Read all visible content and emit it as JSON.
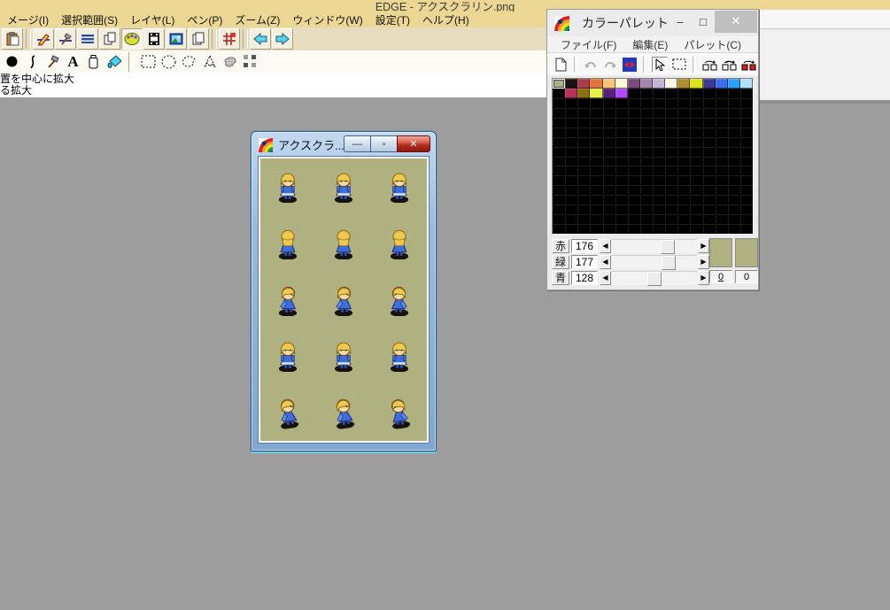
{
  "main_window": {
    "title": "EDGE - アクスクラリン.png",
    "menu_items": [
      "メージ(I)",
      "選択範囲(S)",
      "レイヤ(L)",
      "ペン(P)",
      "ズーム(Z)",
      "ウィンドウ(W)",
      "設定(T)",
      "ヘルプ(H)"
    ],
    "status_lines": [
      "置を中心に拡大",
      "る拡大"
    ],
    "colors": {
      "titlebar": "#ecd694",
      "toolbar": "#e6dcc0",
      "client_area": "#9d9d9d"
    }
  },
  "sprite_window": {
    "title": "アクスクラ...",
    "caption_buttons": {
      "minimize": "—",
      "restore": "▫",
      "close": "✕"
    },
    "canvas_color": "#b0b180",
    "sprite_sheet": {
      "rows": 5,
      "cols": 3,
      "subject": "blonde-girl-blue-dress-walk-cycle",
      "row_poses": [
        "front-stand",
        "back",
        "side-walk",
        "front-walk",
        "side-run"
      ],
      "row_flips": [
        [
          1,
          1,
          1
        ],
        [
          1,
          1,
          1
        ],
        [
          1,
          1,
          -1
        ],
        [
          1,
          1,
          1
        ],
        [
          1,
          1,
          -1
        ]
      ]
    }
  },
  "palette_window": {
    "title": "カラーパレット",
    "caption_buttons": {
      "minimize": "–",
      "maximize": "□",
      "close": "✕"
    },
    "menu_items": [
      "ファイル(F)",
      "編集(E)",
      "パレット(C)"
    ],
    "toolbar_icons": [
      "new-file-icon",
      "undo-icon",
      "redo-icon",
      "swap-colors-icon",
      "cursor-icon",
      "select-rect-icon",
      "copy-palette-icon",
      "copy-palette-multi-icon",
      "copy-palette-fill-icon"
    ],
    "grid": {
      "cols": 16,
      "rows": 16,
      "selected_index": 0,
      "row1": [
        "#b0b180",
        "#1f0f12",
        "#a93d49",
        "#e0763a",
        "#fec47d",
        "#fdfcd4",
        "#7d4a7c",
        "#a286ab",
        "#c2b5d5",
        "#fdf8e3",
        "#b08d30",
        "#dde414",
        "#3d3a92",
        "#3b6dee",
        "#2fa1f5",
        "#b2e2fd"
      ],
      "row2": [
        "#000000",
        "#b93058",
        "#8d7013",
        "#e9f148",
        "#58207d",
        "#b049f9"
      ],
      "fill_color": "#000000"
    },
    "rgb": {
      "red_label": "赤",
      "red": 176,
      "green_label": "緑",
      "green": 177,
      "blue_label": "青",
      "blue": 128,
      "max": 255
    },
    "current_color": "#b0b180",
    "index_left": "0",
    "index_right": "0"
  },
  "toolbar1_icons": [
    "paste-icon",
    "pencil-edit-icon",
    "hammer-tool-icon",
    "dither-screen-icon",
    "copy-pages-icon",
    "palette-icon",
    "filmstrip-icon",
    "image-view-icon",
    "duplicate-icon",
    "grid-icon",
    "arrow-left-icon",
    "arrow-right-icon"
  ],
  "toolbar2_icons": [
    "dot-pen-icon",
    "curve-icon",
    "hammer-icon",
    "text-icon",
    "eraser-icon",
    "bucket-fill-icon",
    "select-rect-icon",
    "select-ellipse-icon",
    "lasso-icon",
    "polygon-select-icon",
    "magic-wand-icon",
    "move-pattern-icon"
  ]
}
